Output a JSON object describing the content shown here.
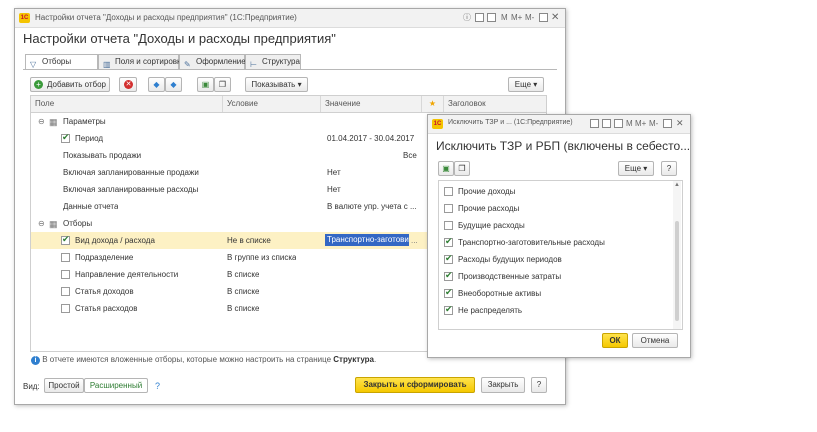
{
  "main": {
    "window_title": "Настройки отчета \"Доходы и расходы предприятия\"  (1С:Предприятие)",
    "heading": "Настройки отчета \"Доходы и расходы предприятия\"",
    "titlebar_buttons": {
      "m": "M",
      "mplus": "M+",
      "mminus": "M-"
    },
    "tabs": [
      {
        "label": "Отборы",
        "icon": "filter-icon"
      },
      {
        "label": "Поля и сортировки",
        "icon": "fields-icon"
      },
      {
        "label": "Оформление",
        "icon": "brush-icon"
      },
      {
        "label": "Структура",
        "icon": "structure-icon"
      }
    ],
    "toolbar": {
      "add_filter": "Добавить отбор",
      "show": "Показывать",
      "more": "Еще"
    },
    "columns": {
      "field": "Поле",
      "condition": "Условие",
      "value": "Значение",
      "header": "Заголовок"
    },
    "groups": {
      "params": "Параметры",
      "filters": "Отборы"
    },
    "rows": [
      {
        "field": "Период",
        "checkbox": true,
        "checked": true,
        "condition": "",
        "value": "01.04.2017 - 30.04.2017"
      },
      {
        "field": "Показывать продажи",
        "checkbox": false,
        "condition": "",
        "value": "Все"
      },
      {
        "field": "Включая запланированные продажи",
        "checkbox": false,
        "condition": "",
        "value": "Нет"
      },
      {
        "field": "Включая запланированные расходы",
        "checkbox": false,
        "condition": "",
        "value": "Нет"
      },
      {
        "field": "Данные отчета",
        "checkbox": false,
        "condition": "",
        "value": "В валюте упр. учета с ..."
      }
    ],
    "filter_rows": [
      {
        "field": "Вид дохода / расхода",
        "checked": true,
        "condition": "Не в списке",
        "value": "Транспортно-заготови",
        "selected": true
      },
      {
        "field": "Подразделение",
        "checked": false,
        "condition": "В группе из списка",
        "value": ""
      },
      {
        "field": "Направление деятельности",
        "checked": false,
        "condition": "В списке",
        "value": ""
      },
      {
        "field": "Статья доходов",
        "checked": false,
        "condition": "В списке",
        "value": ""
      },
      {
        "field": "Статья расходов",
        "checked": false,
        "condition": "В списке",
        "value": ""
      }
    ],
    "info_text": "В отчете имеются вложенные отборы, которые можно настроить на странице ",
    "info_link": "Структура",
    "footer": {
      "view_label": "Вид:",
      "simple": "Простой",
      "extended": "Расширенный",
      "help": "?",
      "close_build": "Закрыть и сформировать",
      "close": "Закрыть"
    }
  },
  "dialog": {
    "window_title": "Исключить ТЗР и ... (1С:Предприятие)",
    "heading": "Исключить ТЗР и РБП (включены в себесто...",
    "more": "Еще",
    "help": "?",
    "items": [
      {
        "label": "Прочие доходы",
        "checked": false
      },
      {
        "label": "Прочие расходы",
        "checked": false
      },
      {
        "label": "Будущие расходы",
        "checked": false
      },
      {
        "label": "Транспортно-заготовительные расходы",
        "checked": true
      },
      {
        "label": "Расходы будущих периодов",
        "checked": true
      },
      {
        "label": "Производственные затраты",
        "checked": true
      },
      {
        "label": "Внеоборотные активы",
        "checked": true
      },
      {
        "label": "Не распределять",
        "checked": true
      }
    ],
    "ok": "ОК",
    "cancel": "Отмена"
  },
  "colors": {
    "accent_yellow": "#f5c800",
    "selection": "#fdf1c4",
    "link_green": "#2e7d32",
    "info_blue": "#2f7fcf"
  }
}
